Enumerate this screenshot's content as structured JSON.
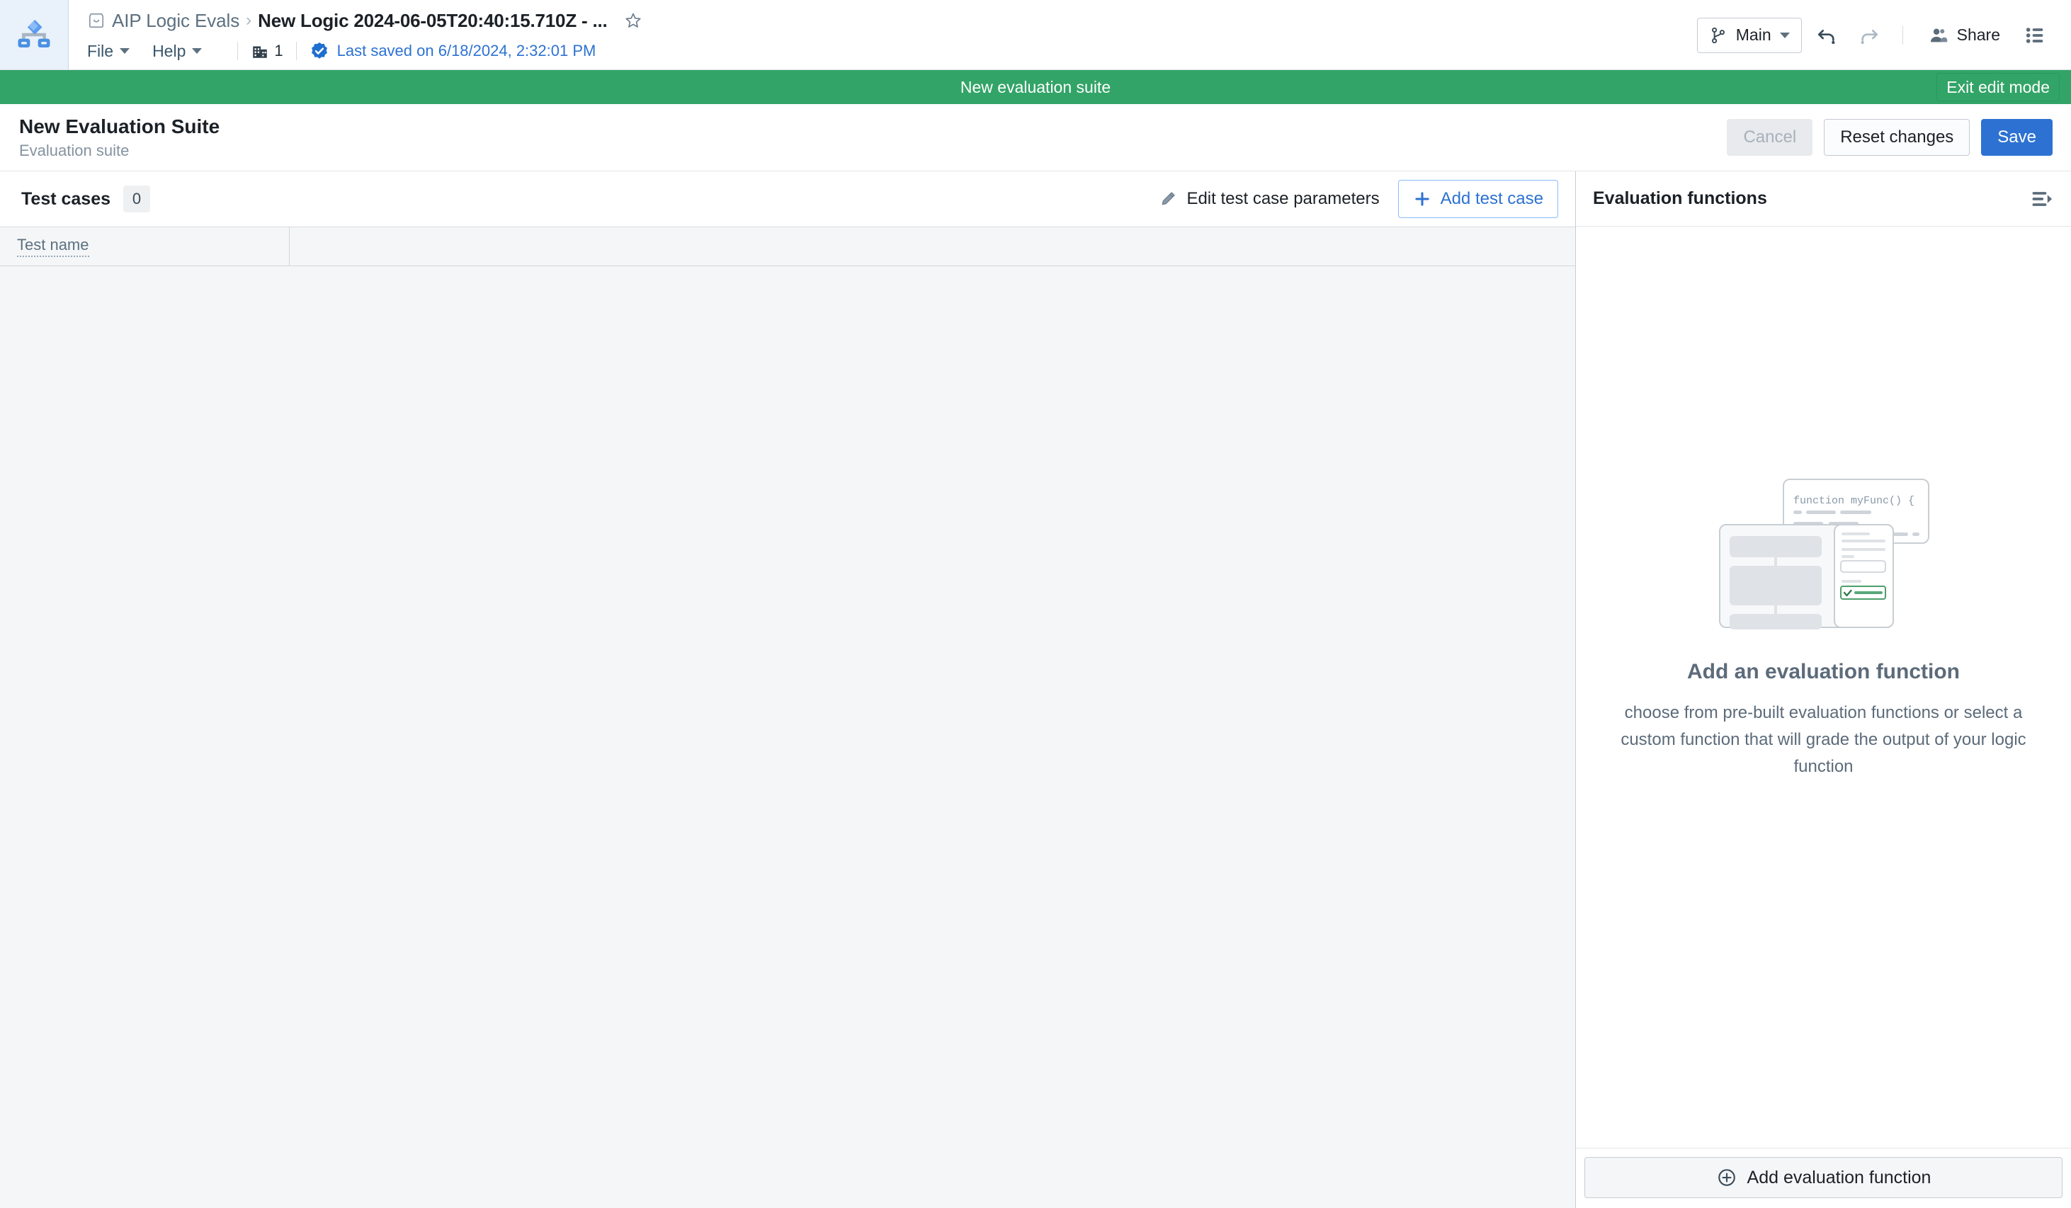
{
  "topbar": {
    "logo_icon": "logic-flow-logo-icon",
    "breadcrumb": {
      "folder_icon": "folder-icon",
      "parent": "AIP Logic Evals",
      "separator": "›",
      "current": "New Logic 2024-06-05T20:40:15.710Z - ...",
      "star_icon": "star-outline-icon"
    },
    "menus": [
      {
        "label": "File",
        "icon": "chevron-down-icon"
      },
      {
        "label": "Help",
        "icon": "chevron-down-icon"
      }
    ],
    "org": {
      "icon": "building-icon",
      "count": "1"
    },
    "save_status": {
      "icon": "check-badge-icon",
      "text": "Last saved on 6/18/2024, 2:32:01 PM"
    },
    "branch": {
      "icon": "branch-icon",
      "label": "Main",
      "caret_icon": "chevron-down-icon"
    },
    "undo_icon": "undo-icon",
    "redo_icon": "redo-icon",
    "share": {
      "icon": "people-icon",
      "label": "Share"
    },
    "properties_icon": "list-properties-icon"
  },
  "edit_banner": {
    "label": "New evaluation suite",
    "exit_label": "Exit edit mode",
    "color": "#32a467"
  },
  "page_header": {
    "title": "New Evaluation Suite",
    "subtitle": "Evaluation suite",
    "actions": {
      "cancel": "Cancel",
      "reset": "Reset changes",
      "save": "Save",
      "save_color": "#2d72d2"
    }
  },
  "test_cases": {
    "title": "Test cases",
    "count": "0",
    "edit_params": {
      "icon": "pencil-icon",
      "label": "Edit test case parameters"
    },
    "add_test_case": {
      "icon": "plus-icon",
      "label": "Add test case"
    },
    "columns": [
      "Test name"
    ],
    "rows": []
  },
  "evaluation_functions": {
    "title": "Evaluation functions",
    "collapse_icon": "panel-collapse-icon",
    "empty_state": {
      "illustration": "code-function-card-illustration",
      "code_snippet": "function myFunc() {",
      "title": "Add an evaluation function",
      "description": "choose from pre-built evaluation functions or select a custom function that will grade the output of your logic function"
    },
    "footer_button": {
      "icon": "circle-plus-icon",
      "label": "Add evaluation function"
    }
  }
}
